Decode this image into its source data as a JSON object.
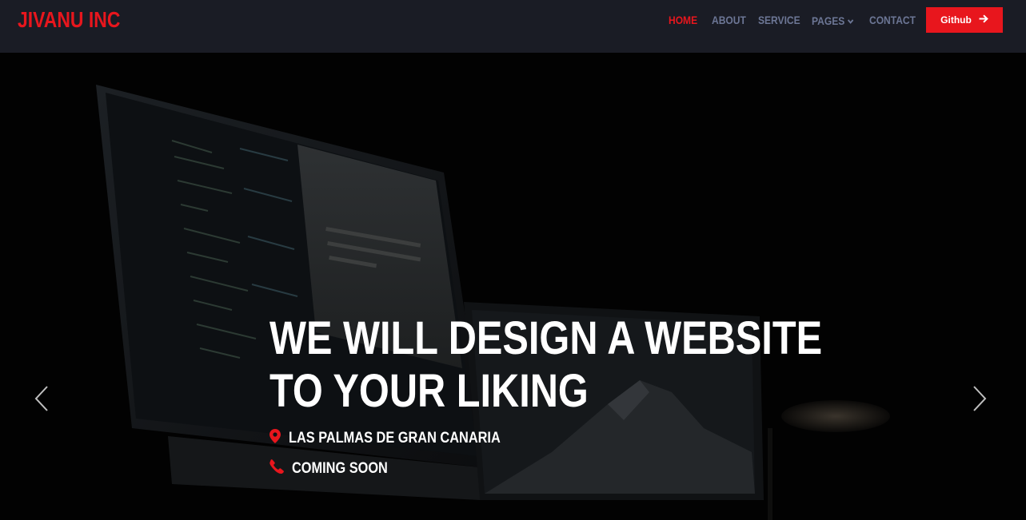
{
  "brand": {
    "name": "JIVANU INC"
  },
  "nav": {
    "items": [
      {
        "label": "HOME",
        "active": true
      },
      {
        "label": "ABOUT"
      },
      {
        "label": "SERVICE"
      },
      {
        "label": "PAGES"
      },
      {
        "label": "CONTACT"
      }
    ],
    "github_label": "Github"
  },
  "hero": {
    "title_line1": "WE WILL DESIGN A WEBSITE",
    "title_line2": "TO YOUR LIKING",
    "location": "LAS PALMAS DE GRAN CANARIA",
    "phone": "COMING SOON",
    "icons": {
      "location": "map-pin-icon",
      "phone": "phone-icon",
      "prev": "chevron-left-icon",
      "next": "chevron-right-icon"
    }
  },
  "colors": {
    "accent": "#e8161d",
    "nav_bg": "#1a1c25",
    "nav_text": "#6c7695",
    "hero_text": "#ffffff"
  }
}
